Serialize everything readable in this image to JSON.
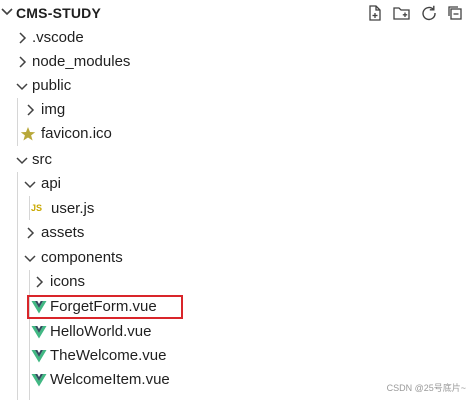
{
  "header": {
    "project_title": "CMS-STUDY",
    "actions": [
      {
        "name": "new-file",
        "icon": "new-file-icon"
      },
      {
        "name": "new-folder",
        "icon": "new-folder-icon"
      },
      {
        "name": "refresh",
        "icon": "refresh-icon"
      },
      {
        "name": "collapse-all",
        "icon": "collapse-all-icon"
      }
    ]
  },
  "tree": {
    "vscode": ".vscode",
    "node_modules": "node_modules",
    "public": "public",
    "img": "img",
    "favicon": "favicon.ico",
    "src": "src",
    "api": "api",
    "user_js": "user.js",
    "js_badge": "JS",
    "assets": "assets",
    "components": "components",
    "icons": "icons",
    "forget_form": "ForgetForm.vue",
    "hello_world": "HelloWorld.vue",
    "the_welcome": "TheWelcome.vue",
    "welcome_item": "WelcomeItem.vue"
  },
  "watermark": "CSDN @25号底片~",
  "colors": {
    "vue_green": "#41b883",
    "vue_dark": "#34495e",
    "favicon_star": "#b8a83a",
    "js_yellow": "#c9a800",
    "selection_border": "#d9252a"
  }
}
